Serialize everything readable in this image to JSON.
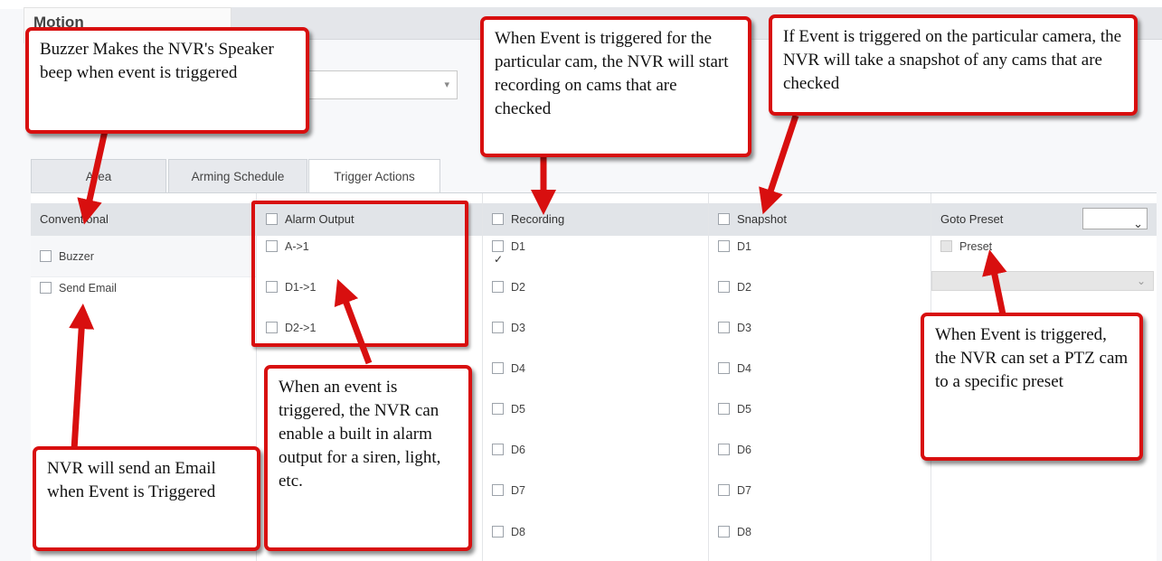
{
  "header": {
    "title": "Motion"
  },
  "tabs": [
    {
      "label": "Area",
      "active": false
    },
    {
      "label": "Arming Schedule",
      "active": false
    },
    {
      "label": "Trigger Actions",
      "active": true
    }
  ],
  "columns": {
    "conventional": {
      "header": "Conventional",
      "rows": [
        {
          "label": "Buzzer",
          "checked": false
        },
        {
          "label": "Send Email",
          "checked": false
        }
      ]
    },
    "alarm_output": {
      "header": "Alarm Output",
      "rows": [
        {
          "label": "A->1",
          "checked": false
        },
        {
          "label": "D1->1",
          "checked": false
        },
        {
          "label": "D2->1",
          "checked": false
        }
      ]
    },
    "recording": {
      "header": "Recording",
      "rows": [
        {
          "label": "D1",
          "checked": true
        },
        {
          "label": "D2",
          "checked": false
        },
        {
          "label": "D3",
          "checked": false
        },
        {
          "label": "D4",
          "checked": false
        },
        {
          "label": "D5",
          "checked": false
        },
        {
          "label": "D6",
          "checked": false
        },
        {
          "label": "D7",
          "checked": false
        },
        {
          "label": "D8",
          "checked": false
        }
      ]
    },
    "snapshot": {
      "header": "Snapshot",
      "rows": [
        {
          "label": "D1",
          "checked": false
        },
        {
          "label": "D2",
          "checked": false
        },
        {
          "label": "D3",
          "checked": false
        },
        {
          "label": "D4",
          "checked": false
        },
        {
          "label": "D5",
          "checked": false
        },
        {
          "label": "D6",
          "checked": false
        },
        {
          "label": "D7",
          "checked": false
        },
        {
          "label": "D8",
          "checked": false
        }
      ]
    },
    "goto_preset": {
      "header": "Goto Preset",
      "preset_label": "Preset"
    }
  },
  "callouts": {
    "buzzer": "Buzzer Makes the NVR's Speaker beep when event is triggered",
    "recording": "When Event is triggered for the particular cam, the NVR will start recording on cams that are checked",
    "snapshot": "If Event is triggered on the particular camera, the NVR will take a snapshot of any cams that are checked",
    "email": "NVR will send an Email when Event is Triggered",
    "alarm": "When an event is triggered, the NVR can enable a built in alarm output for a siren, light, etc.",
    "preset": "When Event is triggered, the NVR can set a PTZ cam to a specific preset"
  },
  "colors": {
    "callout_border": "#d80f0f",
    "header_bg": "#e1e4e8"
  }
}
